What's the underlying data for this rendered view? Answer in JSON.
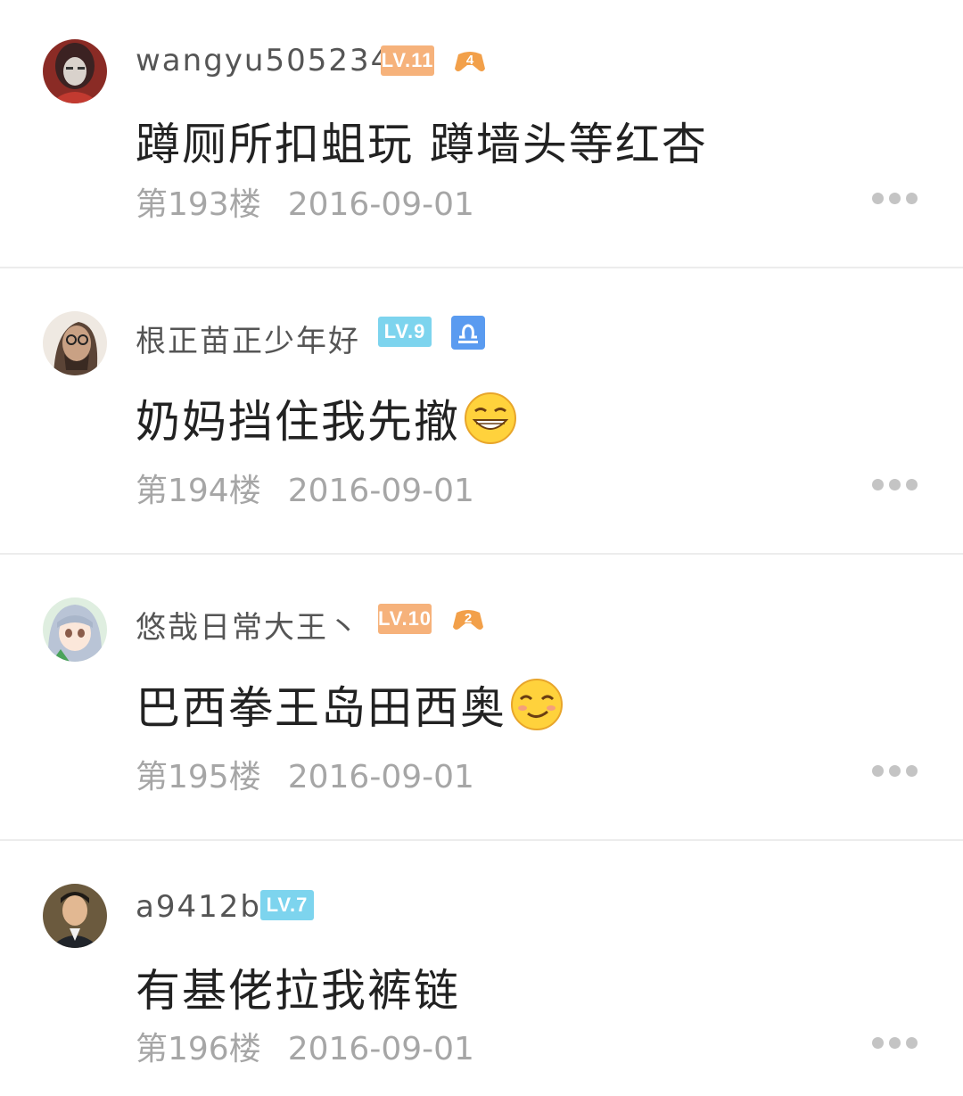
{
  "posts": [
    {
      "username": "wangyu505234",
      "level": "LV.11",
      "level_color": "#f6b27b",
      "badge": "4",
      "badge_icon": "gamepad-icon",
      "content": "蹲厕所扣蛆玩 蹲墙头等红杏",
      "emoji": null,
      "floor": "第193楼",
      "date": "2016-09-01"
    },
    {
      "username": "根正苗正少年好",
      "level": "LV.9",
      "level_color": "#7dd4ee",
      "badge": "♎",
      "badge_icon": "libra-zodiac-icon",
      "content": "奶妈挡住我先撤",
      "emoji": "grin-emoji-icon",
      "floor": "第194楼",
      "date": "2016-09-01"
    },
    {
      "username": "悠哉日常大王丶",
      "level": "LV.10",
      "level_color": "#f6b27b",
      "badge": "2",
      "badge_icon": "gamepad-icon",
      "content": "巴西拳王岛田西奥",
      "emoji": "smug-emoji-icon",
      "floor": "第195楼",
      "date": "2016-09-01"
    },
    {
      "username": "a9412b",
      "level": "LV.7",
      "level_color": "#7dd4ee",
      "badge": null,
      "content": "有基佬拉我裤链",
      "emoji": null,
      "floor": "第196楼",
      "date": "2016-09-01"
    }
  ]
}
